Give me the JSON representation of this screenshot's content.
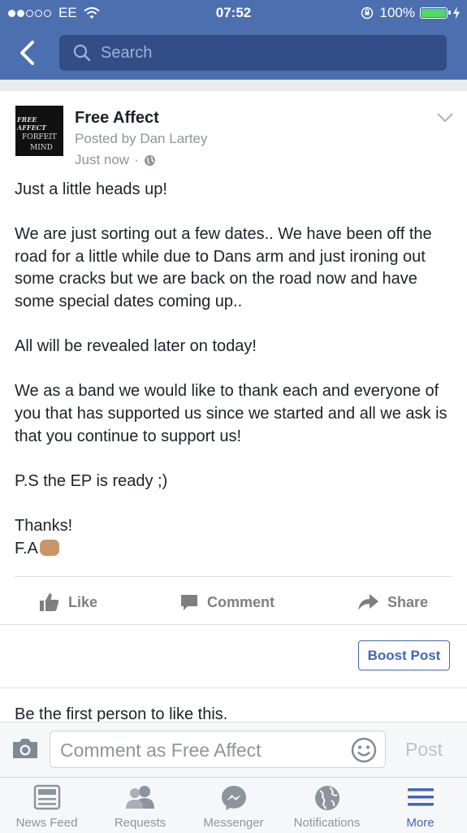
{
  "status_bar": {
    "carrier": "EE",
    "time": "07:52",
    "battery": "100%"
  },
  "search": {
    "placeholder": "Search"
  },
  "post": {
    "page_name": "Free Affect",
    "posted_by": "Posted by Dan Lartey",
    "time_ago": "Just now",
    "separator": "·",
    "avatar_text": {
      "line1": "FREE AFFECT",
      "line2": "FORFEIT",
      "line3": "MIND"
    },
    "paragraphs": [
      "Just a little heads up!",
      "We are just sorting out a few dates.. We have been off the road for a little while due to Dans arm and just ironing out some cracks but we are back on the road now and have some special dates coming up..",
      "All will be revealed later on today!",
      "We as a band we would like to thank each and everyone of you that has supported us since we started and all we ask is that you continue to support us!",
      "P.S the EP is ready ;)"
    ],
    "sign_off": "Thanks!",
    "signature": "F.A"
  },
  "actions": {
    "like": "Like",
    "comment": "Comment",
    "share": "Share"
  },
  "boost_label": "Boost Post",
  "likes_prompt": "Be the first person to like this.",
  "composer": {
    "placeholder": "Comment as Free Affect",
    "post_label": "Post"
  },
  "tabs": [
    {
      "label": "News Feed",
      "icon": "news-feed-icon"
    },
    {
      "label": "Requests",
      "icon": "requests-icon"
    },
    {
      "label": "Messenger",
      "icon": "messenger-icon"
    },
    {
      "label": "Notifications",
      "icon": "globe-icon"
    },
    {
      "label": "More",
      "icon": "menu-icon",
      "active": true
    }
  ],
  "colors": {
    "brand": "#4c6faf",
    "accent": "#4267b2",
    "battery": "#4cd964"
  }
}
